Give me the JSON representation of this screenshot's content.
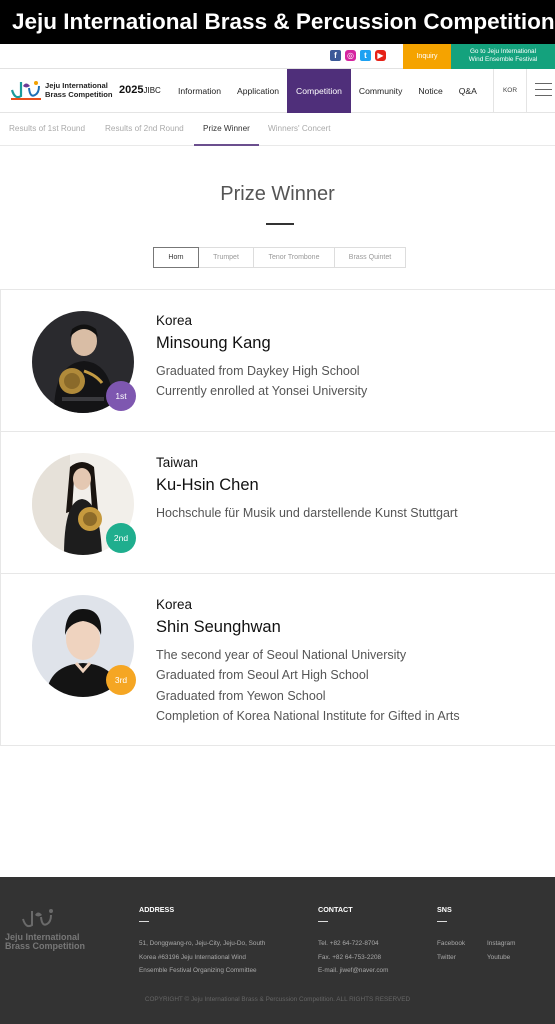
{
  "banner": {
    "title": "Jeju International Brass & Percussion Competition"
  },
  "topbar": {
    "sns_icons": [
      "facebook-icon",
      "instagram-icon",
      "twitter-icon",
      "youtube-icon"
    ],
    "inquiry_label": "Inquiry",
    "festival_link_line1": "Go to Jeju International",
    "festival_link_line2": "Wind Ensemble Festival",
    "colors": {
      "inquiry": "#f5a300",
      "festival": "#14a27d"
    }
  },
  "navbar": {
    "logo_line1": "Jeju International",
    "logo_line2": "Brass Competition",
    "year": "2025",
    "year_suffix": "JIBC",
    "menu": [
      "Information",
      "Application",
      "Competition",
      "Community",
      "Notice",
      "Q&A"
    ],
    "active_menu": "Competition",
    "language": "KOR",
    "accent_color": "#4f2f7a"
  },
  "subnav": {
    "items": [
      "Results of 1st Round",
      "Results of 2nd Round",
      "Prize Winner",
      "Winners' Concert"
    ],
    "active": "Prize Winner"
  },
  "page": {
    "title": "Prize Winner"
  },
  "instrument_tabs": {
    "items": [
      "Horn",
      "Trumpet",
      "Tenor Trombone",
      "Brass Quintet"
    ],
    "active": "Horn"
  },
  "winners": [
    {
      "country": "Korea",
      "name": "Minsoung Kang",
      "rank": "1st",
      "rank_color": "#7e57b0",
      "details": [
        "Graduated from Daykey High School",
        "Currently enrolled at Yonsei University"
      ]
    },
    {
      "country": "Taiwan",
      "name": "Ku-Hsin Chen",
      "rank": "2nd",
      "rank_color": "#1fae8e",
      "details": [
        "Hochschule für Musik und darstellende Kunst Stuttgart"
      ]
    },
    {
      "country": "Korea",
      "name": "Shin Seunghwan",
      "rank": "3rd",
      "rank_color": "#f5a623",
      "details": [
        "The second year of Seoul National University",
        "Graduated from Seoul Art High School",
        "Graduated from Yewon School",
        "Completion of Korea National Institute for Gifted in Arts"
      ]
    }
  ],
  "footer": {
    "logo_line1": "Jeju International",
    "logo_line2": "Brass Competition",
    "address_head": "ADDRESS",
    "address_lines": [
      "51, Donggwang-ro, Jeju-City, Jeju-Do, South",
      "Korea #63196 Jeju International Wind",
      "Ensemble Festival Organizing Committee"
    ],
    "contact_head": "CONTACT",
    "contact_lines": [
      "Tel. +82 64-722-8704",
      "Fax. +82 64-753-2208",
      "E-mail. jiwef@naver.com"
    ],
    "sns_head": "SNS",
    "sns_col1": [
      "Facebook",
      "Twitter"
    ],
    "sns_col2": [
      "Instagram",
      "Youtube"
    ],
    "copyright": "COPYRIGHT © Jeju International Brass & Percussion Competition. ALL RIGHTS RESERVED"
  }
}
